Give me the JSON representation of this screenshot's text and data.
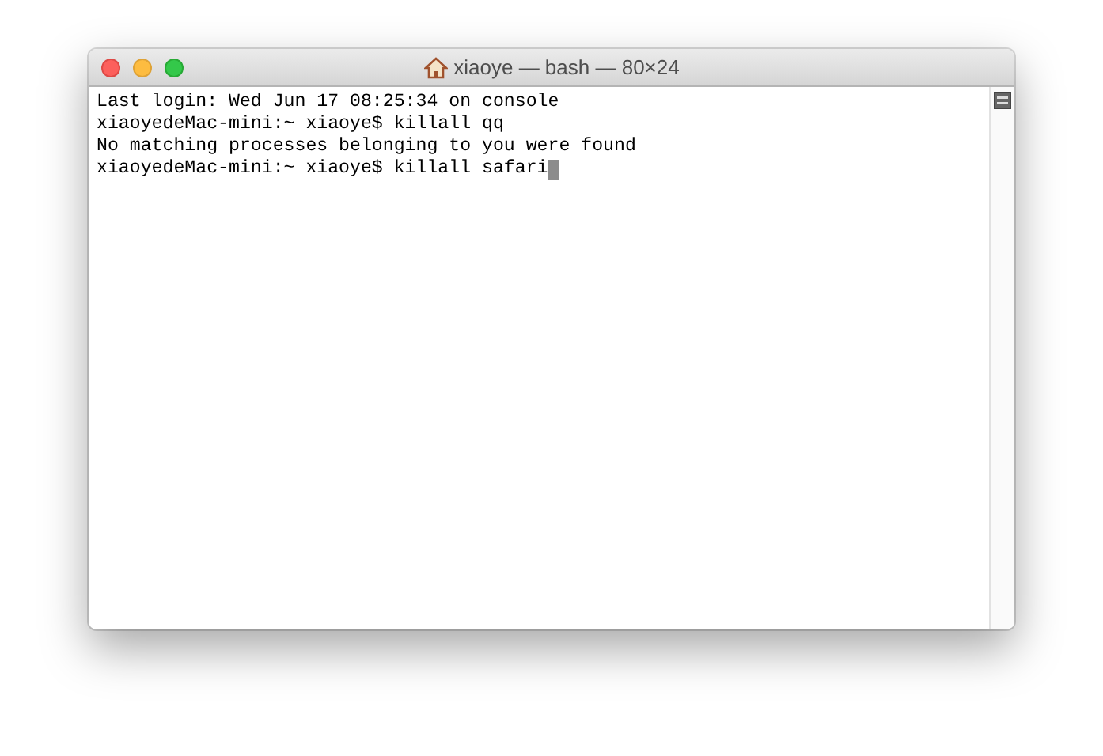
{
  "window": {
    "title": "xiaoye — bash — 80×24"
  },
  "terminal": {
    "lines": [
      {
        "text": "Last login: Wed Jun 17 08:25:34 on console",
        "cursor": false
      },
      {
        "text": "xiaoyedeMac-mini:~ xiaoye$ killall qq",
        "cursor": false
      },
      {
        "text": "No matching processes belonging to you were found",
        "cursor": false
      },
      {
        "text": "xiaoyedeMac-mini:~ xiaoye$ killall safari",
        "cursor": true
      }
    ]
  }
}
